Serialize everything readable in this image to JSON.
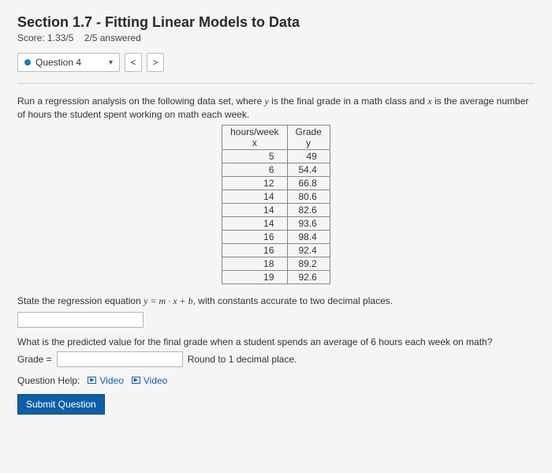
{
  "header": {
    "title": "Section 1.7 - Fitting Linear Models to Data",
    "score_label": "Score: 1.33/5",
    "answered_label": "2/5 answered"
  },
  "qbar": {
    "question_label": "Question 4",
    "prev_glyph": "<",
    "next_glyph": ">",
    "caret": "▾"
  },
  "prompt": {
    "line1_a": "Run a regression analysis on the following data set, where ",
    "y_var": "y",
    "line1_b": " is the final grade in a math class and ",
    "x_var": "x",
    "line1_c": " is the average number of hours the student spent working on math each week."
  },
  "chart_data": {
    "type": "table",
    "col1_header": "hours/week",
    "col1_sub": "x",
    "col2_header": "Grade",
    "col2_sub": "y",
    "rows": [
      {
        "x": "5",
        "y": "49"
      },
      {
        "x": "6",
        "y": "54.4"
      },
      {
        "x": "12",
        "y": "66.8"
      },
      {
        "x": "14",
        "y": "80.6"
      },
      {
        "x": "14",
        "y": "82.6"
      },
      {
        "x": "14",
        "y": "93.6"
      },
      {
        "x": "16",
        "y": "98.4"
      },
      {
        "x": "16",
        "y": "92.4"
      },
      {
        "x": "18",
        "y": "89.2"
      },
      {
        "x": "19",
        "y": "92.6"
      }
    ]
  },
  "eq": {
    "pre": "State the regression equation ",
    "formula": "y = m · x + b",
    "post": ", with constants accurate to two decimal places."
  },
  "q2": {
    "text": "What is the predicted value for the final grade when a student spends an average of 6 hours each week on math?",
    "grade_label": "Grade =",
    "round_hint": "Round to 1 decimal place."
  },
  "help": {
    "label": "Question Help:",
    "video1": "Video",
    "video2": "Video"
  },
  "submit": {
    "label": "Submit Question"
  }
}
